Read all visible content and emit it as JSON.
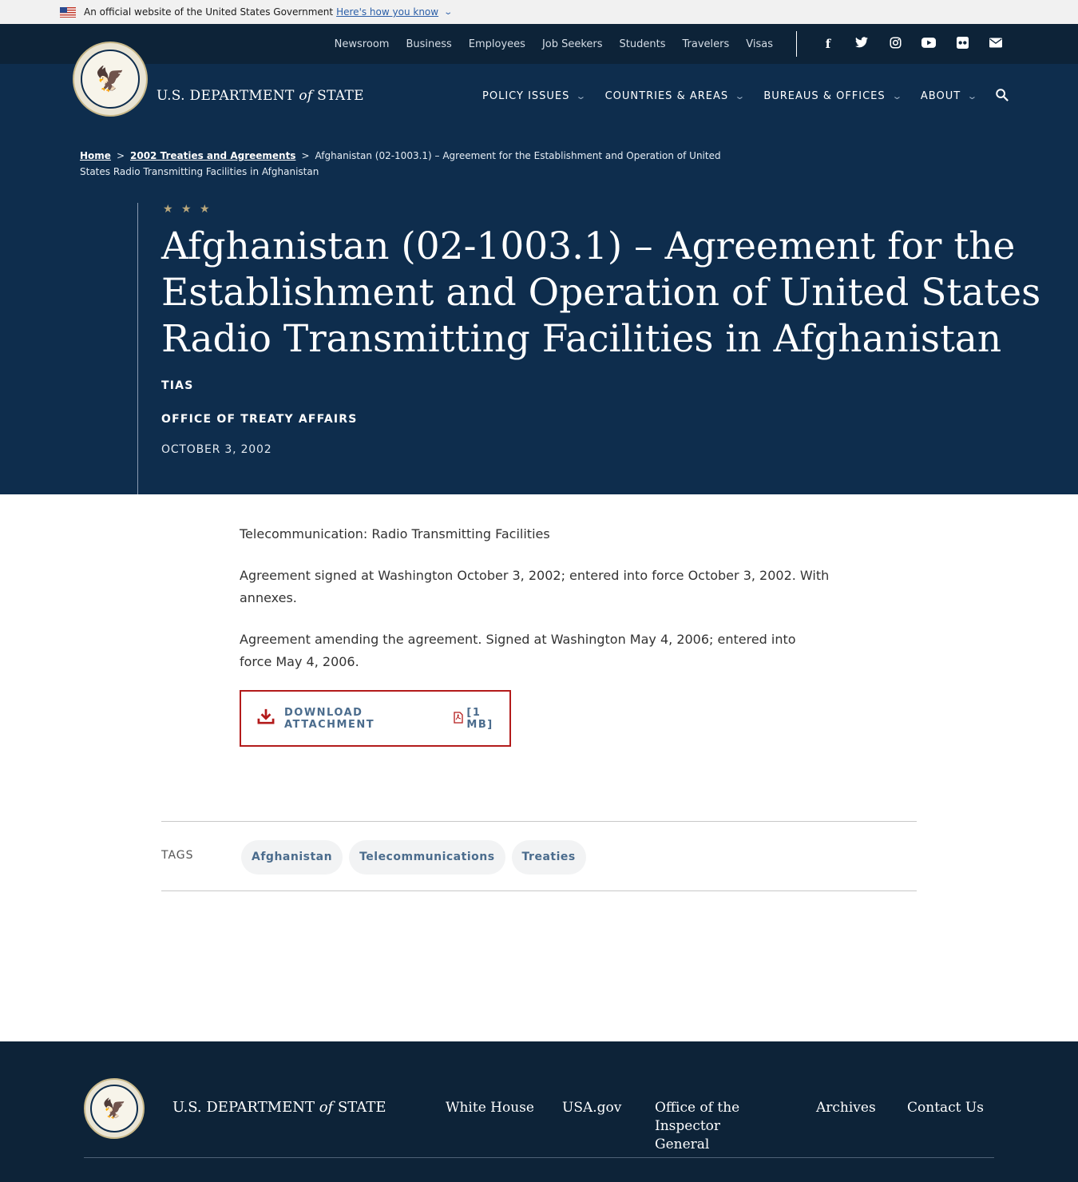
{
  "gov_banner": {
    "text": "An official website of the United States Government",
    "link": "Here's how you know"
  },
  "top_nav": {
    "links": [
      "Newsroom",
      "Business",
      "Employees",
      "Job Seekers",
      "Students",
      "Travelers",
      "Visas"
    ],
    "social_icons": [
      "facebook-icon",
      "twitter-icon",
      "instagram-icon",
      "youtube-icon",
      "flickr-icon",
      "email-icon"
    ]
  },
  "header": {
    "brand_prefix": "U.S. DEPARTMENT",
    "brand_of": "of",
    "brand_suffix": "STATE",
    "main_nav": [
      "POLICY ISSUES",
      "COUNTRIES & AREAS",
      "BUREAUS & OFFICES",
      "ABOUT"
    ]
  },
  "breadcrumb": {
    "home": "Home",
    "parent": "2002 Treaties and Agreements",
    "current": "Afghanistan (02-1003.1) – Agreement for the Establishment and Operation of United States Radio Transmitting Facilities in Afghanistan",
    "separator": ">"
  },
  "hero": {
    "stars": "★ ★ ★",
    "title": "Afghanistan (02-1003.1) – Agreement for the Establishment and Operation of United States Radio Transmitting Facilities in Afghanistan",
    "collection": "TIAS",
    "office": "OFFICE OF TREATY AFFAIRS",
    "date": "OCTOBER 3, 2002"
  },
  "content": {
    "paragraphs": [
      "Telecommunication: Radio Transmitting Facilities",
      "Agreement signed at Washington October 3, 2002; entered into force October 3, 2002. With annexes.",
      "Agreement amending the agreement. Signed at Washington May 4, 2006; entered into force May 4, 2006."
    ],
    "download": {
      "label": "DOWNLOAD ATTACHMENT",
      "size": "[1 MB]"
    }
  },
  "tags": {
    "label": "TAGS",
    "items": [
      "Afghanistan",
      "Telecommunications",
      "Treaties"
    ]
  },
  "footer": {
    "brand_prefix": "U.S. DEPARTMENT",
    "brand_of": "of",
    "brand_suffix": "STATE",
    "links": [
      "White House",
      "USA.gov",
      "Office of the Inspector General",
      "Archives",
      "Contact Us"
    ]
  },
  "colors": {
    "navy": "#0e2d4d",
    "dark_navy": "#0d2338",
    "accent_red": "#b31b1b",
    "link_blue": "#4b6c8d"
  }
}
